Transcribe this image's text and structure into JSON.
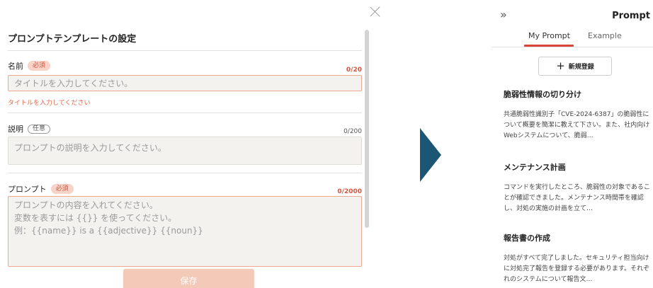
{
  "modal": {
    "title": "プロンプトテンプレートの設定",
    "name_field": {
      "label": "名前",
      "badge": "必須",
      "counter": "0/20",
      "placeholder": "タイトルを入力してください。",
      "error": "タイトルを入力してください"
    },
    "desc_field": {
      "label": "説明",
      "badge": "任意",
      "counter": "0/200",
      "placeholder": "プロンプトの説明を入力してください。"
    },
    "prompt_field": {
      "label": "プロンプト",
      "badge": "必須",
      "counter": "0/2000",
      "placeholder_line1": "プロンプトの内容を入れてください。",
      "placeholder_line2": "変数を表すには {{}} を使ってください。",
      "placeholder_line3": "例：{{name}} is a {{adjective}} {{noun}}"
    },
    "save_label": "保存"
  },
  "panel": {
    "title": "Prompt",
    "tabs": [
      {
        "label": "My Prompt",
        "active": true
      },
      {
        "label": "Example",
        "active": false
      }
    ],
    "new_button_label": "新規登録",
    "cards": [
      {
        "title": "脆弱性情報の切り分け",
        "body": "共通脆弱性識別子「CVE-2024-6387」の脆弱性について概要を簡潔に教えて下さい。また、社内向けWebシステムについて、脆弱…"
      },
      {
        "title": "メンテナンス計画",
        "body": "コマンドを実行したところ、脆弱性の対象であることが確認できました。メンテナンス時間帯を確認し、対処の実施の計画を立て…"
      },
      {
        "title": "報告書の作成",
        "body": "対処がすべて完了しました。セキュリティ担当向けに対処完了報告を登録する必要があります。それぞれのシステムについて報告文…"
      }
    ]
  },
  "colors": {
    "accent_red": "#d8463a",
    "arrow": "#1b5774",
    "save_button": "#f3c9b7"
  }
}
